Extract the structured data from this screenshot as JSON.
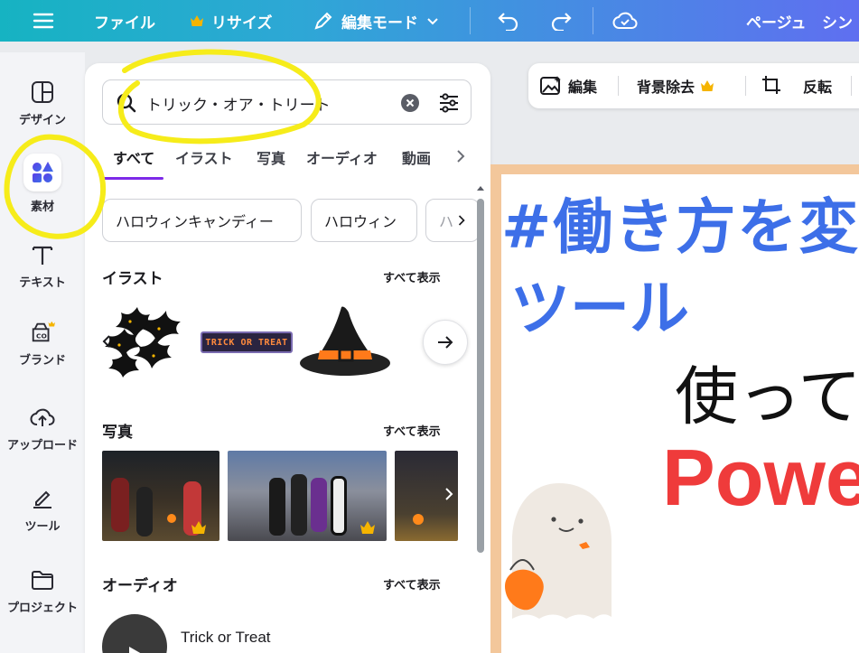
{
  "topbar": {
    "file": "ファイル",
    "resize": "リサイズ",
    "edit_mode": "編集モード",
    "page": "ページュ",
    "share_partial": "シン"
  },
  "sidebar": {
    "items": [
      {
        "label": "デザイン",
        "icon": "layout-icon"
      },
      {
        "label": "素材",
        "icon": "elements-icon"
      },
      {
        "label": "テキスト",
        "icon": "text-icon"
      },
      {
        "label": "ブランド",
        "icon": "brand-icon"
      },
      {
        "label": "アップロード",
        "icon": "upload-icon"
      },
      {
        "label": "ツール",
        "icon": "tools-icon"
      },
      {
        "label": "プロジェクト",
        "icon": "folder-icon"
      }
    ]
  },
  "panel": {
    "search_value": "トリック・オア・トリート",
    "tabs": [
      "すべて",
      "イラスト",
      "写真",
      "オーディオ",
      "動画"
    ],
    "chips": [
      "ハロウィンキャンディー",
      "ハロウィン",
      "ハ"
    ],
    "illust": {
      "title": "イラスト",
      "see_all": "すべて表示",
      "trick_or_treat_text": "TRICK OR TREAT"
    },
    "photos": {
      "title": "写真",
      "see_all": "すべて表示"
    },
    "audio": {
      "title": "オーディオ",
      "see_all": "すべて表示",
      "track": "Trick or Treat"
    }
  },
  "toolbar": {
    "edit": "編集",
    "bg_remove": "背景除去",
    "flip": "反転"
  },
  "canvas": {
    "line1": "#働き方を変",
    "line2": "ツール",
    "line3": "使って",
    "line4": "Powe"
  },
  "colors": {
    "accent": "#7d2ae8",
    "crown": "#f5b400",
    "headline_blue": "#3d6fe8",
    "headline_red": "#ef3b3b",
    "annotation_yellow": "#f6ec1a"
  }
}
